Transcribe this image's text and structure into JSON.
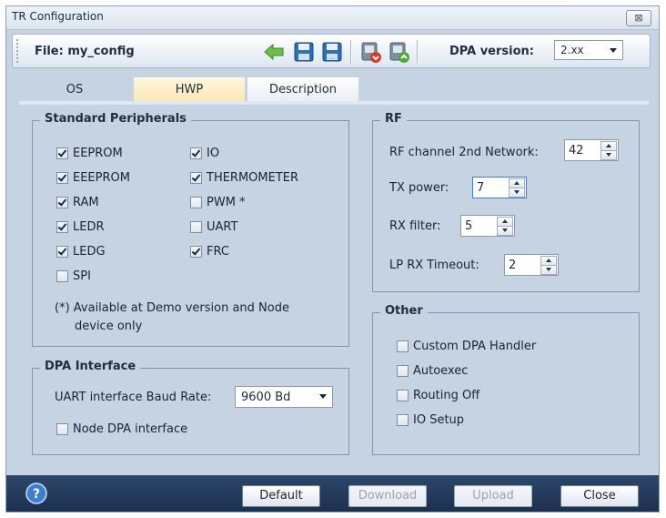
{
  "window": {
    "title": "TR Configuration",
    "close_glyph": "⊠"
  },
  "toolbar": {
    "file_label": "File: my_config",
    "dpa_label": "DPA version:",
    "dpa_version": "2.xx",
    "icons": [
      "back-arrow-icon",
      "save-icon",
      "save-as-icon",
      "download-icon",
      "upload-icon"
    ]
  },
  "tabs": [
    {
      "label": "OS",
      "active": false
    },
    {
      "label": "HWP",
      "active": true
    },
    {
      "label": "Description",
      "active": false
    }
  ],
  "standard_peripherals": {
    "title": "Standard Peripherals",
    "left": [
      {
        "label": "EEPROM",
        "checked": true
      },
      {
        "label": "EEEPROM",
        "checked": true
      },
      {
        "label": "RAM",
        "checked": true
      },
      {
        "label": "LEDR",
        "checked": true
      },
      {
        "label": "LEDG",
        "checked": true
      },
      {
        "label": "SPI",
        "checked": false
      }
    ],
    "right": [
      {
        "label": "IO",
        "checked": true
      },
      {
        "label": "THERMOMETER",
        "checked": true
      },
      {
        "label": "PWM *",
        "checked": false
      },
      {
        "label": "UART",
        "checked": false
      },
      {
        "label": "FRC",
        "checked": true
      }
    ],
    "note_line1": "(*) Available at Demo version and Node",
    "note_line2": "device only"
  },
  "dpa_interface": {
    "title": "DPA Interface",
    "baud_label": "UART interface Baud Rate:",
    "baud_value": "9600 Bd",
    "node_dpa_label": "Node DPA interface",
    "node_dpa_checked": false
  },
  "rf": {
    "title": "RF",
    "channel_label": "RF channel 2nd Network:",
    "channel_value": "42",
    "tx_label": "TX power:",
    "tx_value": "7",
    "rx_label": "RX filter:",
    "rx_value": "5",
    "lp_label": "LP RX Timeout:",
    "lp_value": "2"
  },
  "other": {
    "title": "Other",
    "items": [
      {
        "label": "Custom DPA Handler",
        "checked": false
      },
      {
        "label": "Autoexec",
        "checked": false
      },
      {
        "label": "Routing Off",
        "checked": false
      },
      {
        "label": "IO Setup",
        "checked": false
      }
    ]
  },
  "footer": {
    "default_label": "Default",
    "download_label": "Download",
    "upload_label": "Upload",
    "close_label": "Close"
  },
  "colors": {
    "accent": "#1c3050",
    "active_tab": "#fce6b4",
    "panel": "#c6d3e2"
  }
}
